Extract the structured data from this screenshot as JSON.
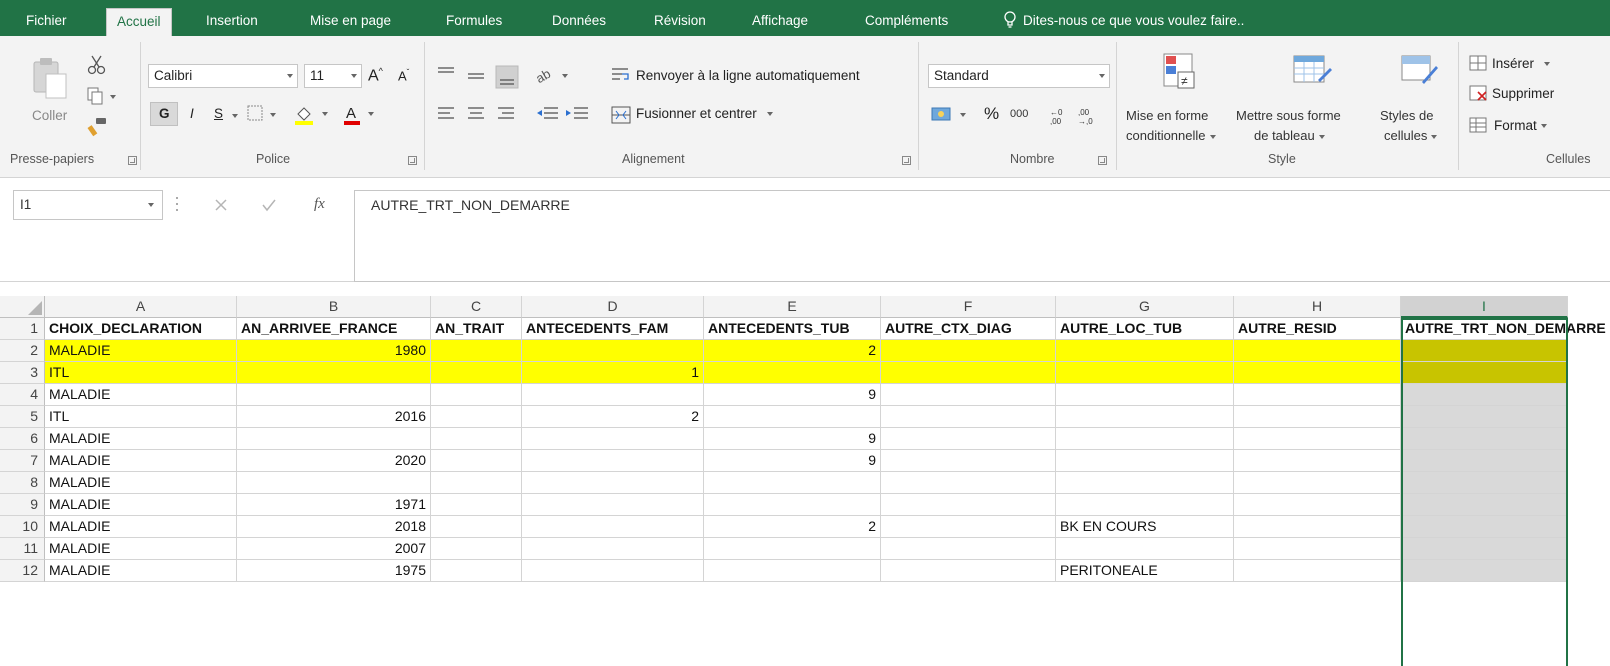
{
  "ribbon_tabs": [
    "Fichier",
    "Accueil",
    "Insertion",
    "Mise en page",
    "Formules",
    "Données",
    "Révision",
    "Affichage",
    "Compléments"
  ],
  "active_tab": "Accueil",
  "tell_me": "Dites-nous ce que vous voulez faire..",
  "clipboard": {
    "paste": "Coller",
    "group": "Presse-papiers"
  },
  "font": {
    "name": "Calibri",
    "size": "11",
    "bold": "G",
    "italic": "I",
    "underline": "S",
    "group": "Police"
  },
  "alignment": {
    "wrap": "Renvoyer à la ligne automatiquement",
    "merge": "Fusionner et centrer",
    "group": "Alignement"
  },
  "number": {
    "format": "Standard",
    "percent": "%",
    "thousands": "000",
    "group": "Nombre"
  },
  "styles": {
    "conditional_1": "Mise en forme",
    "conditional_2": "conditionnelle",
    "table_1": "Mettre sous forme",
    "table_2": "de tableau",
    "cell_1": "Styles de",
    "cell_2": "cellules",
    "group": "Style"
  },
  "cells": {
    "insert": "Insérer",
    "delete": "Supprimer",
    "format": "Format",
    "group": "Cellules"
  },
  "formula_bar": {
    "name_box": "I1",
    "fx": "fx",
    "content": "AUTRE_TRT_NON_DEMARRE"
  },
  "colors": {
    "accent": "#217346",
    "highlight": "#ffff00",
    "selected_column": "#d9d9d9"
  },
  "sheet": {
    "columns": [
      "A",
      "B",
      "C",
      "D",
      "E",
      "F",
      "G",
      "H",
      "I"
    ],
    "selected_column": "I",
    "row_numbers": [
      "1",
      "2",
      "3",
      "4",
      "5",
      "6",
      "7",
      "8",
      "9",
      "10",
      "11",
      "12"
    ],
    "header": [
      "CHOIX_DECLARATION",
      "AN_ARRIVEE_FRANCE",
      "AN_TRAIT",
      "ANTECEDENTS_FAM",
      "ANTECEDENTS_TUB",
      "AUTRE_CTX_DIAG",
      "AUTRE_LOC_TUB",
      "AUTRE_RESID",
      "AUTRE_TRT_NON_DEMARRE"
    ],
    "rows": [
      [
        "MALADIE",
        "1980",
        "",
        "",
        "2",
        "",
        "",
        "",
        ""
      ],
      [
        "ITL",
        "",
        "",
        "1",
        "",
        "",
        "",
        "",
        ""
      ],
      [
        "MALADIE",
        "",
        "",
        "",
        "9",
        "",
        "",
        "",
        ""
      ],
      [
        "ITL",
        "2016",
        "",
        "2",
        "",
        "",
        "",
        "",
        ""
      ],
      [
        "MALADIE",
        "",
        "",
        "",
        "9",
        "",
        "",
        "",
        ""
      ],
      [
        "MALADIE",
        "2020",
        "",
        "",
        "9",
        "",
        "",
        "",
        ""
      ],
      [
        "MALADIE",
        "",
        "",
        "",
        "",
        "",
        "",
        "",
        ""
      ],
      [
        "MALADIE",
        "1971",
        "",
        "",
        "",
        "",
        "",
        "",
        ""
      ],
      [
        "MALADIE",
        "2018",
        "",
        "",
        "2",
        "",
        "BK EN COURS",
        "",
        ""
      ],
      [
        "MALADIE",
        "2007",
        "",
        "",
        "",
        "",
        "",
        "",
        ""
      ],
      [
        "MALADIE",
        "1975",
        "",
        "",
        "",
        "",
        "PERITONEALE",
        "",
        ""
      ]
    ]
  }
}
